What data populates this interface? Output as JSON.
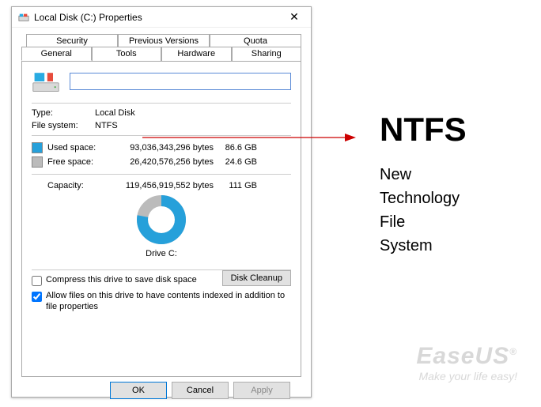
{
  "titlebar": {
    "title": "Local Disk (C:) Properties"
  },
  "tabs": {
    "back": [
      "Security",
      "Previous Versions",
      "Quota"
    ],
    "front": [
      "General",
      "Tools",
      "Hardware",
      "Sharing"
    ],
    "active": "General"
  },
  "volume": {
    "name": ""
  },
  "info": {
    "type_label": "Type:",
    "type_value": "Local Disk",
    "fs_label": "File system:",
    "fs_value": "NTFS"
  },
  "space": {
    "used": {
      "label": "Used space:",
      "bytes": "93,036,343,296 bytes",
      "hr": "86.6 GB"
    },
    "free": {
      "label": "Free space:",
      "bytes": "26,420,576,256 bytes",
      "hr": "24.6 GB"
    },
    "capacity": {
      "label": "Capacity:",
      "bytes": "119,456,919,552 bytes",
      "hr": "111 GB"
    }
  },
  "drive_label": "Drive C:",
  "buttons": {
    "cleanup": "Disk Cleanup",
    "ok": "OK",
    "cancel": "Cancel",
    "apply": "Apply"
  },
  "options": {
    "compress": "Compress this drive to save disk space",
    "index": "Allow files on this drive to have contents indexed in addition to file properties"
  },
  "chart_data": {
    "type": "pie",
    "title": "Drive C:",
    "series": [
      {
        "name": "Used space",
        "value": 93036343296,
        "color": "#26a0da"
      },
      {
        "name": "Free space",
        "value": 26420576256,
        "color": "#bbbbbb"
      }
    ]
  },
  "annotation": {
    "heading": "NTFS",
    "lines": [
      "New",
      "Technology",
      "File",
      "System"
    ]
  },
  "watermark": {
    "main": "EaseUS",
    "reg": "®",
    "sub": "Make your life easy!"
  }
}
